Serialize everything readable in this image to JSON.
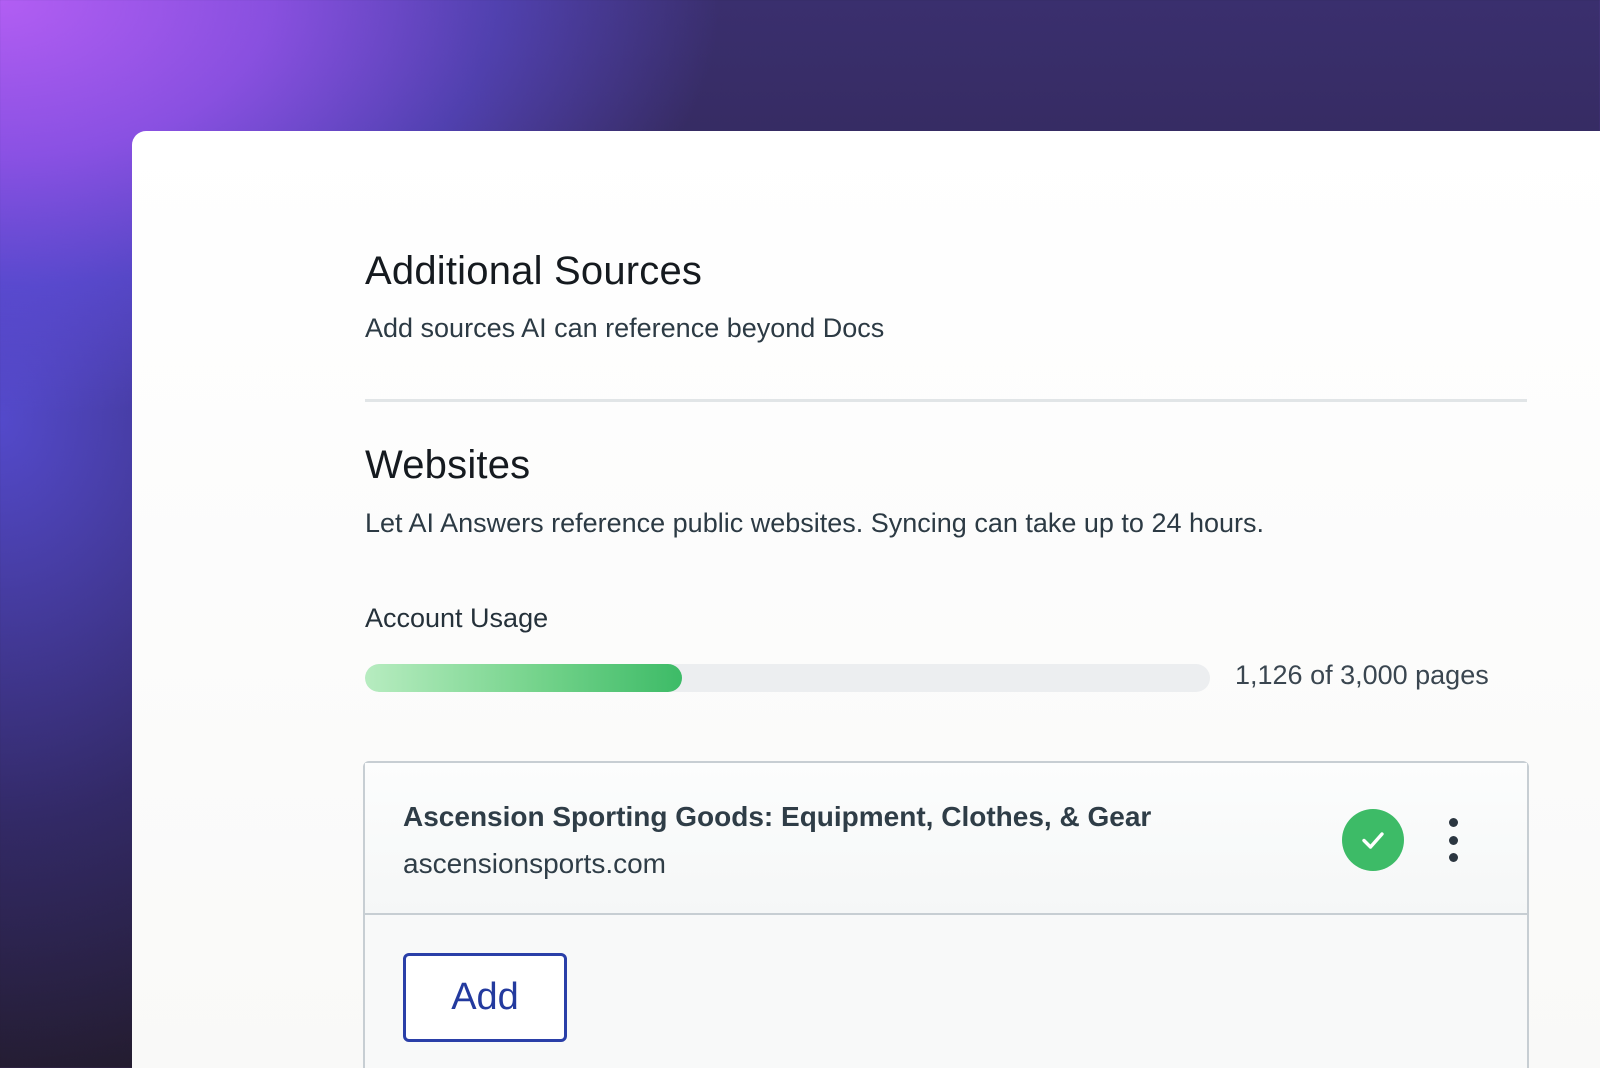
{
  "theme": {
    "accent": "#2a3fa8",
    "success": "#3dbb67",
    "text_primary": "#151a1f",
    "text_secondary": "#2f3d47"
  },
  "additional_sources": {
    "title": "Additional Sources",
    "subtitle": "Add sources AI can reference beyond Docs"
  },
  "websites": {
    "title": "Websites",
    "subtitle": "Let AI Answers reference public websites. Syncing can take up to 24 hours."
  },
  "account_usage": {
    "label": "Account Usage",
    "used_pages": 1126,
    "total_pages": 3000,
    "progress_fraction": 0.375,
    "summary": "1,126 of 3,000 pages"
  },
  "website_list": {
    "items": [
      {
        "title": "Ascension Sporting Goods: Equipment, Clothes, & Gear",
        "url": "ascensionsports.com",
        "status_icon": "check-icon",
        "menu_icon": "kebab-menu-icon"
      }
    ],
    "add_label": "Add"
  }
}
